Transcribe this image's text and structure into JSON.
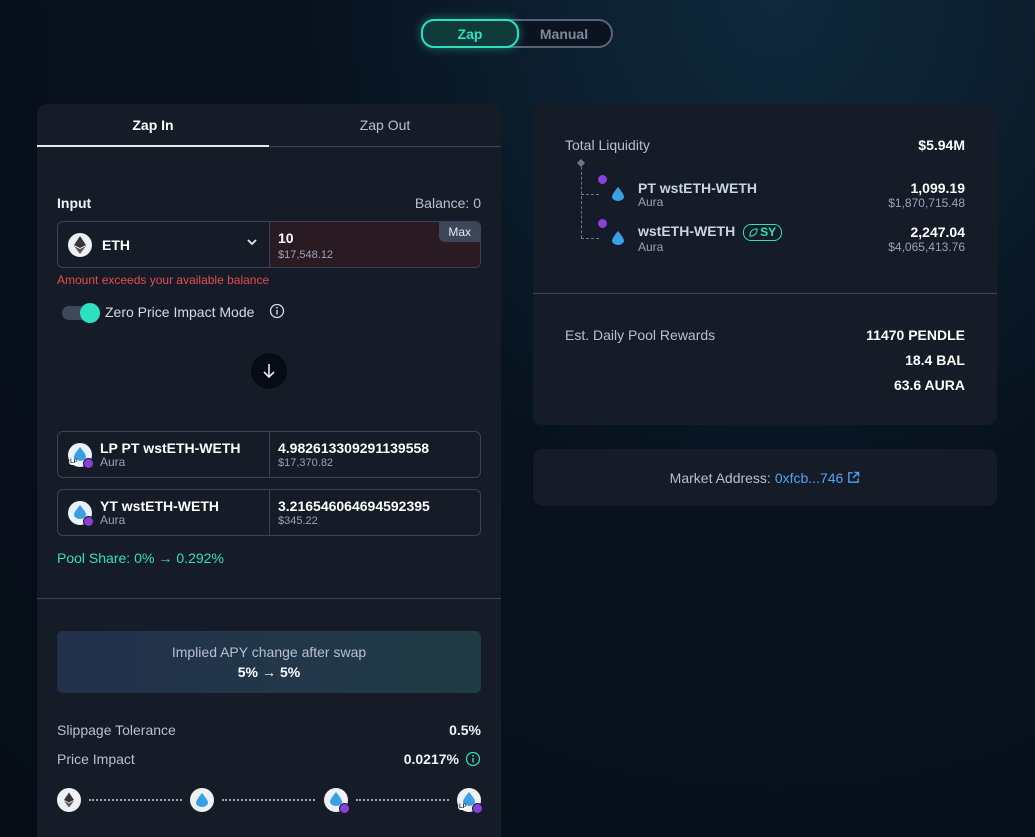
{
  "mode_toggle": {
    "zap_label": "Zap",
    "manual_label": "Manual",
    "active": "Zap"
  },
  "left": {
    "tabs": {
      "zap_in": "Zap In",
      "zap_out": "Zap Out"
    },
    "input_label": "Input",
    "balance": "Balance: 0",
    "token": {
      "symbol": "ETH",
      "icon": "eth-icon"
    },
    "amount_value": "10",
    "amount_usd": "$17,548.12",
    "max_label": "Max",
    "error": "Amount exceeds your available balance",
    "zero_price_impact_label": "Zero Price Impact Mode",
    "zero_price_impact_on": true,
    "outputs": [
      {
        "name": "LP PT wstETH-WETH",
        "sub": "Aura",
        "amount": "4.982613309291139558",
        "usd": "$17,370.82",
        "lp": "LP"
      },
      {
        "name": "YT wstETH-WETH",
        "sub": "Aura",
        "amount": "3.216546064694592395",
        "usd": "$345.22"
      }
    ],
    "pool_share": {
      "label": "Pool Share:",
      "from": "0%",
      "to": "0.292%"
    },
    "apy_box": {
      "title": "Implied APY change after swap",
      "from": "5%",
      "to": "5%"
    },
    "slippage": {
      "label": "Slippage Tolerance",
      "value": "0.5%"
    },
    "price_impact": {
      "label": "Price Impact",
      "value": "0.0217%"
    }
  },
  "right": {
    "total_liquidity_label": "Total Liquidity",
    "total_liquidity_value": "$5.94M",
    "assets": [
      {
        "name": "PT wstETH-WETH",
        "sub": "Aura",
        "amount": "1,099.19",
        "usd": "$1,870,715.48"
      },
      {
        "name": "wstETH-WETH",
        "sub": "Aura",
        "amount": "2,247.04",
        "usd": "$4,065,413.76",
        "badge": "SY"
      }
    ],
    "rewards_label": "Est. Daily Pool Rewards",
    "rewards": [
      "11470 PENDLE",
      "18.4 BAL",
      "63.6 AURA"
    ]
  },
  "market": {
    "label": "Market Address:",
    "address": "0xfcb...746"
  },
  "colors": {
    "accent": "#2de0c0",
    "error": "#e04e4e",
    "link": "#4fa3f7",
    "card": "#151b27"
  }
}
